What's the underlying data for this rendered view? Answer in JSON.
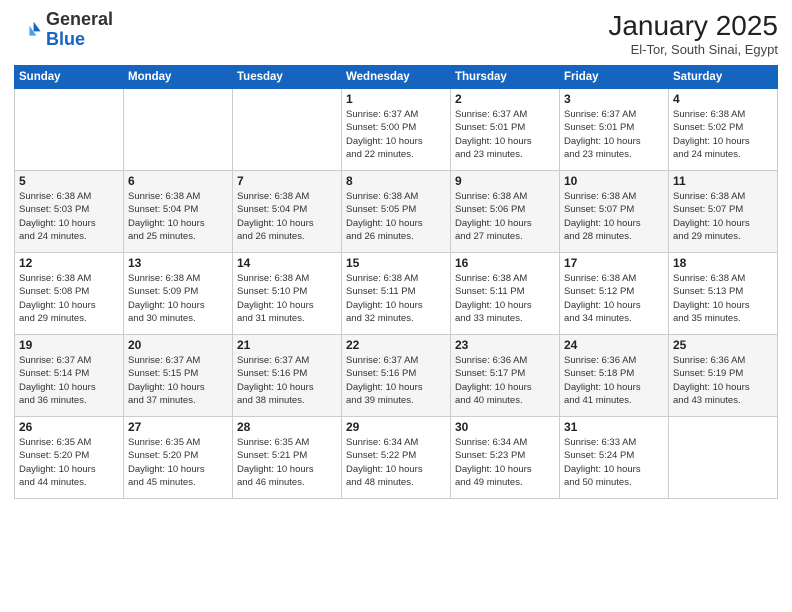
{
  "header": {
    "logo_general": "General",
    "logo_blue": "Blue",
    "month_title": "January 2025",
    "location": "El-Tor, South Sinai, Egypt"
  },
  "days_of_week": [
    "Sunday",
    "Monday",
    "Tuesday",
    "Wednesday",
    "Thursday",
    "Friday",
    "Saturday"
  ],
  "weeks": [
    [
      {
        "day": "",
        "info": ""
      },
      {
        "day": "",
        "info": ""
      },
      {
        "day": "",
        "info": ""
      },
      {
        "day": "1",
        "info": "Sunrise: 6:37 AM\nSunset: 5:00 PM\nDaylight: 10 hours\nand 22 minutes."
      },
      {
        "day": "2",
        "info": "Sunrise: 6:37 AM\nSunset: 5:01 PM\nDaylight: 10 hours\nand 23 minutes."
      },
      {
        "day": "3",
        "info": "Sunrise: 6:37 AM\nSunset: 5:01 PM\nDaylight: 10 hours\nand 23 minutes."
      },
      {
        "day": "4",
        "info": "Sunrise: 6:38 AM\nSunset: 5:02 PM\nDaylight: 10 hours\nand 24 minutes."
      }
    ],
    [
      {
        "day": "5",
        "info": "Sunrise: 6:38 AM\nSunset: 5:03 PM\nDaylight: 10 hours\nand 24 minutes."
      },
      {
        "day": "6",
        "info": "Sunrise: 6:38 AM\nSunset: 5:04 PM\nDaylight: 10 hours\nand 25 minutes."
      },
      {
        "day": "7",
        "info": "Sunrise: 6:38 AM\nSunset: 5:04 PM\nDaylight: 10 hours\nand 26 minutes."
      },
      {
        "day": "8",
        "info": "Sunrise: 6:38 AM\nSunset: 5:05 PM\nDaylight: 10 hours\nand 26 minutes."
      },
      {
        "day": "9",
        "info": "Sunrise: 6:38 AM\nSunset: 5:06 PM\nDaylight: 10 hours\nand 27 minutes."
      },
      {
        "day": "10",
        "info": "Sunrise: 6:38 AM\nSunset: 5:07 PM\nDaylight: 10 hours\nand 28 minutes."
      },
      {
        "day": "11",
        "info": "Sunrise: 6:38 AM\nSunset: 5:07 PM\nDaylight: 10 hours\nand 29 minutes."
      }
    ],
    [
      {
        "day": "12",
        "info": "Sunrise: 6:38 AM\nSunset: 5:08 PM\nDaylight: 10 hours\nand 29 minutes."
      },
      {
        "day": "13",
        "info": "Sunrise: 6:38 AM\nSunset: 5:09 PM\nDaylight: 10 hours\nand 30 minutes."
      },
      {
        "day": "14",
        "info": "Sunrise: 6:38 AM\nSunset: 5:10 PM\nDaylight: 10 hours\nand 31 minutes."
      },
      {
        "day": "15",
        "info": "Sunrise: 6:38 AM\nSunset: 5:11 PM\nDaylight: 10 hours\nand 32 minutes."
      },
      {
        "day": "16",
        "info": "Sunrise: 6:38 AM\nSunset: 5:11 PM\nDaylight: 10 hours\nand 33 minutes."
      },
      {
        "day": "17",
        "info": "Sunrise: 6:38 AM\nSunset: 5:12 PM\nDaylight: 10 hours\nand 34 minutes."
      },
      {
        "day": "18",
        "info": "Sunrise: 6:38 AM\nSunset: 5:13 PM\nDaylight: 10 hours\nand 35 minutes."
      }
    ],
    [
      {
        "day": "19",
        "info": "Sunrise: 6:37 AM\nSunset: 5:14 PM\nDaylight: 10 hours\nand 36 minutes."
      },
      {
        "day": "20",
        "info": "Sunrise: 6:37 AM\nSunset: 5:15 PM\nDaylight: 10 hours\nand 37 minutes."
      },
      {
        "day": "21",
        "info": "Sunrise: 6:37 AM\nSunset: 5:16 PM\nDaylight: 10 hours\nand 38 minutes."
      },
      {
        "day": "22",
        "info": "Sunrise: 6:37 AM\nSunset: 5:16 PM\nDaylight: 10 hours\nand 39 minutes."
      },
      {
        "day": "23",
        "info": "Sunrise: 6:36 AM\nSunset: 5:17 PM\nDaylight: 10 hours\nand 40 minutes."
      },
      {
        "day": "24",
        "info": "Sunrise: 6:36 AM\nSunset: 5:18 PM\nDaylight: 10 hours\nand 41 minutes."
      },
      {
        "day": "25",
        "info": "Sunrise: 6:36 AM\nSunset: 5:19 PM\nDaylight: 10 hours\nand 43 minutes."
      }
    ],
    [
      {
        "day": "26",
        "info": "Sunrise: 6:35 AM\nSunset: 5:20 PM\nDaylight: 10 hours\nand 44 minutes."
      },
      {
        "day": "27",
        "info": "Sunrise: 6:35 AM\nSunset: 5:20 PM\nDaylight: 10 hours\nand 45 minutes."
      },
      {
        "day": "28",
        "info": "Sunrise: 6:35 AM\nSunset: 5:21 PM\nDaylight: 10 hours\nand 46 minutes."
      },
      {
        "day": "29",
        "info": "Sunrise: 6:34 AM\nSunset: 5:22 PM\nDaylight: 10 hours\nand 48 minutes."
      },
      {
        "day": "30",
        "info": "Sunrise: 6:34 AM\nSunset: 5:23 PM\nDaylight: 10 hours\nand 49 minutes."
      },
      {
        "day": "31",
        "info": "Sunrise: 6:33 AM\nSunset: 5:24 PM\nDaylight: 10 hours\nand 50 minutes."
      },
      {
        "day": "",
        "info": ""
      }
    ]
  ]
}
